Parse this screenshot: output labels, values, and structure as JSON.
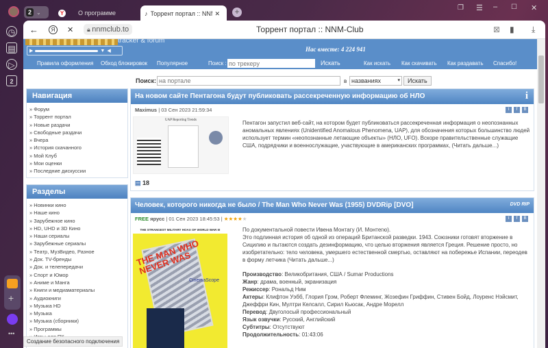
{
  "browser": {
    "tab_count": "2",
    "tabs": [
      {
        "label": "О программе"
      },
      {
        "label": "Торрент портал :: NNM"
      }
    ],
    "url": "nnmclub.to",
    "page_title": "Торрент портал :: NNM-Club",
    "status": "Создание безопасного подключения",
    "sidebar_badge": "2"
  },
  "header": {
    "tagline": "tracker & forum",
    "together": "Нас вместе: 4 224 941"
  },
  "nav": {
    "links": [
      "Правила оформления",
      "Обход блокировок",
      "Популярное"
    ],
    "search_label": "Поиск :",
    "search_placeholder": "по трекеру",
    "search_button": "Искать",
    "right_links": [
      "Как искать",
      "Как скачивать",
      "Как раздавать",
      "Спасибо!"
    ]
  },
  "portal_search": {
    "label": "Поиск:",
    "placeholder": "на портале",
    "in": "в",
    "select": "названиях",
    "button": "Искать"
  },
  "navigation": {
    "title": "Навигация",
    "items": [
      "Форум",
      "Торрент портал",
      "Новые раздачи",
      "Свободные раздачи",
      "Вчера",
      "История скачанного",
      "Мой Клуб",
      "Мои оценки",
      "Последние дискуссии"
    ]
  },
  "sections": {
    "title": "Разделы",
    "items": [
      "Новинки кино",
      "Наше кино",
      "Зарубежное кино",
      "HD, UHD и 3D Кино",
      "Наши сериалы",
      "Зарубежные сериалы",
      "Театр, МузВидео, Разное",
      "Док. TV-бренды",
      "Док. и телепередачи",
      "Спорт и Юмор",
      "Аниме и Манга",
      "Книги и медиаматериалы",
      "Аудиокниги",
      "Музыка HD",
      "Музыка",
      "Музыка (сборники)",
      "Программы",
      "Игры для ПК"
    ]
  },
  "article1": {
    "title": "На новом сайте Пентагона будут публиковать рассекреченную информацию об НЛО",
    "author": "Maximus",
    "date": "03 Сен 2023 21:59:34",
    "image_title": "UAP Reporting Trends",
    "body": "Пентагон запустил веб-сайт, на котором будет публиковаться рассекреченная информация о неопознанных аномальных явлениях (Unidentified Anomalous Phenomena, UAP), для обозначения которых большинство людей использует термин «неопознанные летающие объекты» (НЛО, UFO). Вскоре правительственные служащие США, подрядчики и военнослужащие, участвующие в американских программах,",
    "more": "Читать дальше...",
    "comments": "18"
  },
  "article2": {
    "title": "Человек, которого никогда не было / The Man Who Never Was (1955) DVDRip [DVO]",
    "badge": "DVD RIP",
    "free": "FREE",
    "author": "ярусс",
    "date": "01 Сен 2023 18:45:53",
    "rating": 4,
    "poster": {
      "top": "THE STRANGEST MILITARY HOAX OF WORLD WAR II!",
      "title": "THE MAN WHO NEVER WAS",
      "brand": "CinemaScope"
    },
    "intro": "По документальной повести Ивена Монтагу (И. Монтегю).",
    "body": "Это подлинная история об одной из операций Британской разведки. 1943. Союзники готовят вторжение в Сицилию и пытаются создать дезинформацию, что целью вторжения является Греция. Решение просто, но изобретательно: тело человека, умершего естественной смертью, оставляют на побережье Испании, переодев в форму летчика",
    "more": "Читать дальше...",
    "fields": [
      {
        "k": "Производство",
        "v": "Великобритания, США / Sumar Productions"
      },
      {
        "k": "Жанр",
        "v": "драма, военный, экранизация"
      },
      {
        "k": "Режиссер",
        "v": "Рональд Ним"
      },
      {
        "k": "Актеры",
        "v": "Клифтон Уэбб, Глория Грэм, Роберт Флеминг, Жозефин Гриффин, Стивен Бойд, Лоуренс Нэйсмит, Джеффри Кин, Мултри Келсалл, Сирил Кьюсак, Андре Морелл"
      },
      {
        "k": "Перевод",
        "v": "Двуголосый профессиональный"
      },
      {
        "k": "Язык озвучки",
        "v": "Русский, Английский"
      },
      {
        "k": "Субтитры",
        "v": "Отсутствуют"
      },
      {
        "k": "Продолжительность",
        "v": "01:43:06"
      }
    ]
  }
}
